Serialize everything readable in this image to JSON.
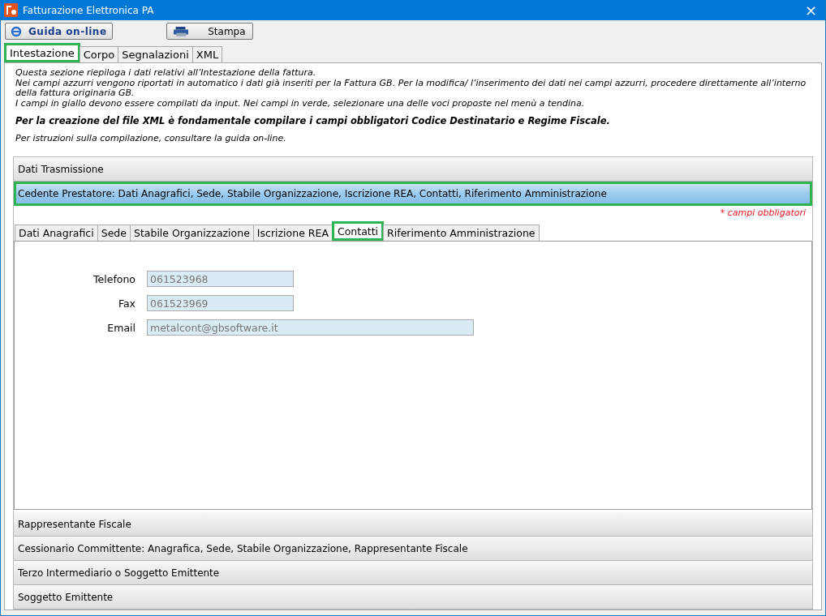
{
  "window": {
    "title": "Fatturazione Elettronica PA",
    "close": "×"
  },
  "toolbar": [
    {
      "kind": "help",
      "label": "Guida on-line"
    },
    {
      "kind": "print",
      "label": "Stampa"
    }
  ],
  "tabs": [
    {
      "label": "Intestazione",
      "selected": true,
      "highlighted": true
    },
    {
      "label": "Corpo",
      "selected": false,
      "highlighted": false
    },
    {
      "label": "Segnalazioni",
      "selected": false,
      "highlighted": false
    },
    {
      "label": "XML",
      "selected": false,
      "highlighted": false
    }
  ],
  "intro": [
    {
      "kind": "plain",
      "text": "Questa sezione riepiloga i dati relativi all’Intestazione della fattura.\nNei campi azzurri vengono riportati in automatico i dati già inseriti per la Fattura GB. Per la modifica/ l’inserimento dei dati nei campi azzurri, procedere direttamente all’interno della fattura originaria GB.\nI campi in giallo devono essere compilati da input. Nei campi in verde, selezionare una delle voci proposte nel menù a tendina."
    },
    {
      "kind": "strong",
      "text": "Per la creazione del file XML è fondamentale compilare i campi obbligatori Codice Destinatario e Regime Fiscale."
    },
    {
      "kind": "plain",
      "text": "Per istruzioni sulla compilazione, consultare la guida on-line."
    }
  ],
  "sections": [
    {
      "title": "Dati Trasmissione",
      "expanded": false,
      "highlighted": false
    },
    {
      "title": "Cedente Prestatore: Dati Anagrafici, Sede, Stabile Organizzazione, Iscrizione REA, Contatti, Riferimento Amministrazione",
      "expanded": true,
      "highlighted": true,
      "required_note": "* campi obbligatori",
      "tabs": [
        {
          "label": "Dati Anagrafici",
          "selected": false,
          "highlighted": false
        },
        {
          "label": "Sede",
          "selected": false,
          "highlighted": false
        },
        {
          "label": "Stabile Organizzazione",
          "selected": false,
          "highlighted": false
        },
        {
          "label": "Iscrizione REA",
          "selected": false,
          "highlighted": false
        },
        {
          "label": "Contatti",
          "selected": true,
          "highlighted": true
        },
        {
          "label": "Riferimento Amministrazione",
          "selected": false,
          "highlighted": false
        }
      ],
      "fields": [
        {
          "label": "Telefono",
          "value": "061523968",
          "wide": false
        },
        {
          "label": "Fax",
          "value": "061523969",
          "wide": false
        },
        {
          "label": "Email",
          "value": "metalcont@gbsoftware.it",
          "wide": true
        }
      ]
    },
    {
      "title": "Rappresentante Fiscale",
      "expanded": false,
      "highlighted": false
    },
    {
      "title": "Cessionario Committente: Anagrafica, Sede, Stabile Organizzazione, Rappresentante Fiscale",
      "expanded": false,
      "highlighted": false
    },
    {
      "title": "Terzo Intermediario o Soggetto Emittente",
      "expanded": false,
      "highlighted": false
    },
    {
      "title": "Soggetto Emittente",
      "expanded": false,
      "highlighted": false
    }
  ]
}
